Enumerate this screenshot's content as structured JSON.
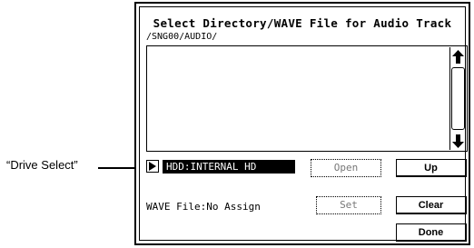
{
  "callout": {
    "label": "“Drive Select”"
  },
  "dialog": {
    "title": "Select Directory/WAVE File for Audio Track",
    "path": "/SNG00/AUDIO/",
    "file_list": [],
    "drive": {
      "value": "HDD:INTERNAL HD"
    },
    "buttons": {
      "open": "Open",
      "up": "Up",
      "set": "Set",
      "clear": "Clear",
      "done": "Done"
    },
    "wave_file_label": "WAVE File:No Assign"
  }
}
